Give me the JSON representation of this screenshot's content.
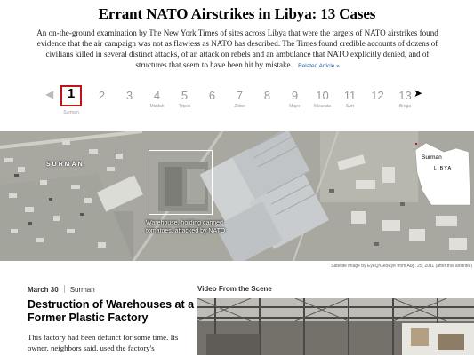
{
  "header": {
    "title": "Errant NATO Airstrikes in Libya: 13 Cases",
    "intro": "An on-the-ground examination by The New York Times of sites across Libya that were the targets of NATO airstrikes found evidence that the air campaign was not as flawless as NATO has described. The Times found credible accounts of dozens of civilians killed in several distinct attacks, of an attack on rebels and an ambulance that NATO explicitly denied, and of structures that seem to have been hit by mistake.",
    "related_link": "Related Article »"
  },
  "pager": {
    "prev_icon": "left-arrow-icon",
    "next_icon": "right-arrow-icon",
    "prev_glyph": "◀",
    "next_glyph": "➤",
    "cases": [
      {
        "num": "1",
        "place": "Surman",
        "active": true
      },
      {
        "num": "2",
        "place": ""
      },
      {
        "num": "3",
        "place": ""
      },
      {
        "num": "4",
        "place": "Mizdah"
      },
      {
        "num": "5",
        "place": "Tripoli"
      },
      {
        "num": "6",
        "place": ""
      },
      {
        "num": "7",
        "place": "Zlitan"
      },
      {
        "num": "8",
        "place": ""
      },
      {
        "num": "9",
        "place": "Majer"
      },
      {
        "num": "10",
        "place": "Misurata"
      },
      {
        "num": "11",
        "place": "Surt"
      },
      {
        "num": "12",
        "place": ""
      },
      {
        "num": "13",
        "place": "Brega"
      }
    ]
  },
  "satellite": {
    "place_label": "SURMAN",
    "callout": "Warehouse, holding canned tomatoes, attacked by NATO",
    "locator_place": "Surman",
    "locator_country": "LIBYA",
    "credit": "Satellite image by EyeQ/GeoEye from Aug. 25, 2011 (after this airstrike)"
  },
  "article": {
    "date": "March 30",
    "location": "Surman",
    "headline": "Destruction of Warehouses at a Former Plastic Factory",
    "body": "This factory had been defunct for some time. Its owner, neighbors said, used the factory's"
  },
  "video": {
    "label": "Video From the Scene"
  },
  "colors": {
    "active_outline": "#c0141a",
    "link": "#2d5d9b"
  }
}
